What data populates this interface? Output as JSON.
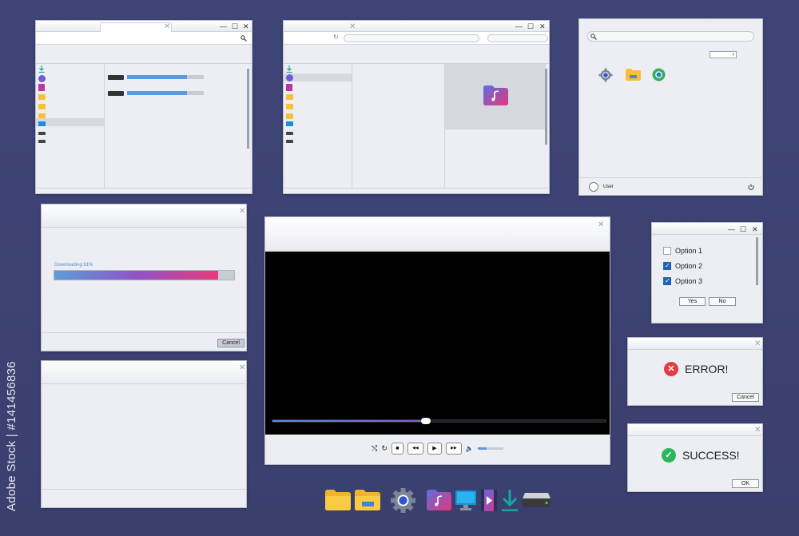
{
  "watermark": "Adobe Stock | #141456836",
  "window_controls": {
    "minimize": "—",
    "maximize": "☐",
    "close": "✕"
  },
  "file_manager": {
    "transfers": [
      {
        "fraction": 0.78
      },
      {
        "fraction": 0.78
      }
    ]
  },
  "start_menu": {
    "arrow": "›",
    "user_label": "User",
    "power_icon": "power-icon"
  },
  "download_dialog": {
    "status": "Downloading 91%",
    "progress_fraction": 0.91,
    "cancel_label": "Cancel"
  },
  "media_player": {
    "progress_fraction": 0.46,
    "volume_fraction": 0.35,
    "shuffle": "⤭",
    "repeat": "↻",
    "stop": "■",
    "prev": "◀◀",
    "play": "▶",
    "next": "▶▶",
    "volume": "🔈"
  },
  "options_dialog": {
    "options": [
      {
        "label": "Option 1",
        "checked": false
      },
      {
        "label": "Option 2",
        "checked": true
      },
      {
        "label": "Option 3",
        "checked": true
      }
    ],
    "yes_label": "Yes",
    "no_label": "No"
  },
  "error_dialog": {
    "message": "ERROR!",
    "icon": "✕",
    "cancel_label": "Cancel"
  },
  "success_dialog": {
    "message": "SUCCESS!",
    "icon": "✓",
    "ok_label": "OK"
  },
  "colors": {
    "accent": "#5b9bdc",
    "gradient_start": "#5a9ed8",
    "gradient_end": "#ea3a7a",
    "error": "#e53946",
    "success": "#2fb35b",
    "folder": "#f6c233"
  },
  "dock_icons": [
    "folder-icon",
    "folder-drive-icon",
    "gear-icon",
    "music-folder-icon",
    "monitor-icon",
    "video-file-icon",
    "download-icon",
    "hard-drive-icon"
  ]
}
